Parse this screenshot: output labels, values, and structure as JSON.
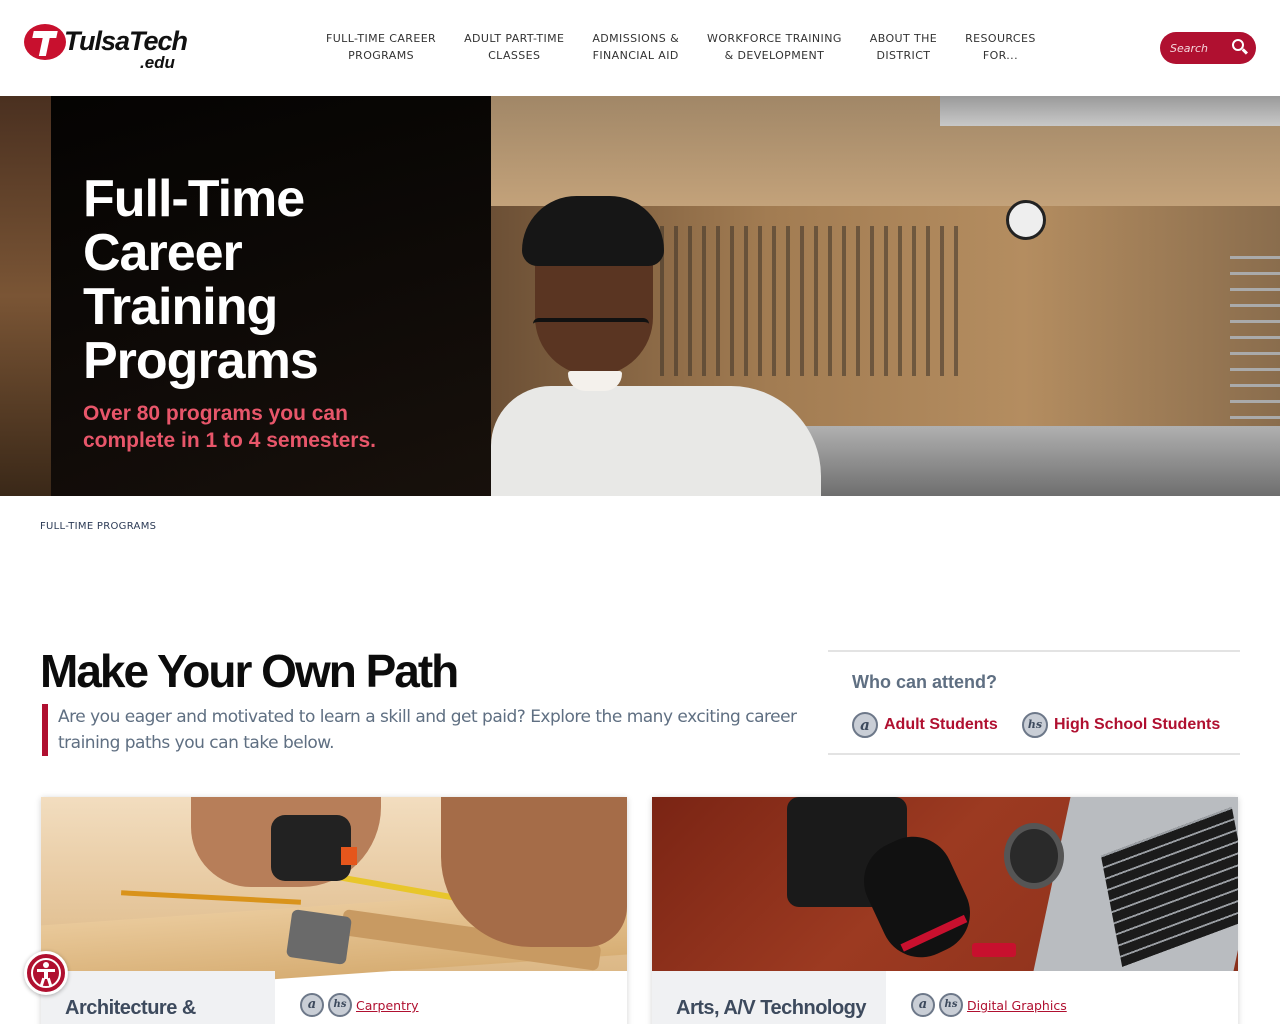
{
  "header": {
    "logo_text": "TulsaTech",
    "logo_suffix": ".edu",
    "nav": [
      {
        "line1": "FULL-TIME CAREER",
        "line2": "PROGRAMS"
      },
      {
        "line1": "ADULT PART-TIME",
        "line2": "CLASSES"
      },
      {
        "line1": "ADMISSIONS &",
        "line2": "FINANCIAL AID"
      },
      {
        "line1": "WORKFORCE TRAINING",
        "line2": "& DEVELOPMENT"
      },
      {
        "line1": "ABOUT THE",
        "line2": "DISTRICT"
      },
      {
        "line1": "RESOURCES",
        "line2": "FOR..."
      }
    ],
    "search_placeholder": "Search",
    "search_icon": "search-icon"
  },
  "hero": {
    "title": "Full-Time Career Training Programs",
    "subtitle": "Over 80 programs you can complete in 1 to 4 semesters."
  },
  "breadcrumb": "FULL-TIME PROGRAMS",
  "intro": {
    "title": "Make Your Own Path",
    "lead": "Are you eager and motivated to learn a skill and get paid? Explore the many exciting career training paths you can take below."
  },
  "attend": {
    "question": "Who can attend?",
    "options": [
      {
        "badge": "a",
        "label": "Adult Students"
      },
      {
        "badge": "hs",
        "label": "High School Students"
      }
    ]
  },
  "cards": [
    {
      "category": "Architecture & Construction",
      "program_badges": [
        "a",
        "hs"
      ],
      "program": "Carpentry"
    },
    {
      "category": "Arts, A/V Technology",
      "program_badges": [
        "a",
        "hs"
      ],
      "program": "Digital Graphics"
    }
  ],
  "colors": {
    "brand": "#b01030",
    "accent_pink": "#e8566a",
    "slate": "#5f6f82"
  },
  "accessibility_icon": "accessibility-icon"
}
